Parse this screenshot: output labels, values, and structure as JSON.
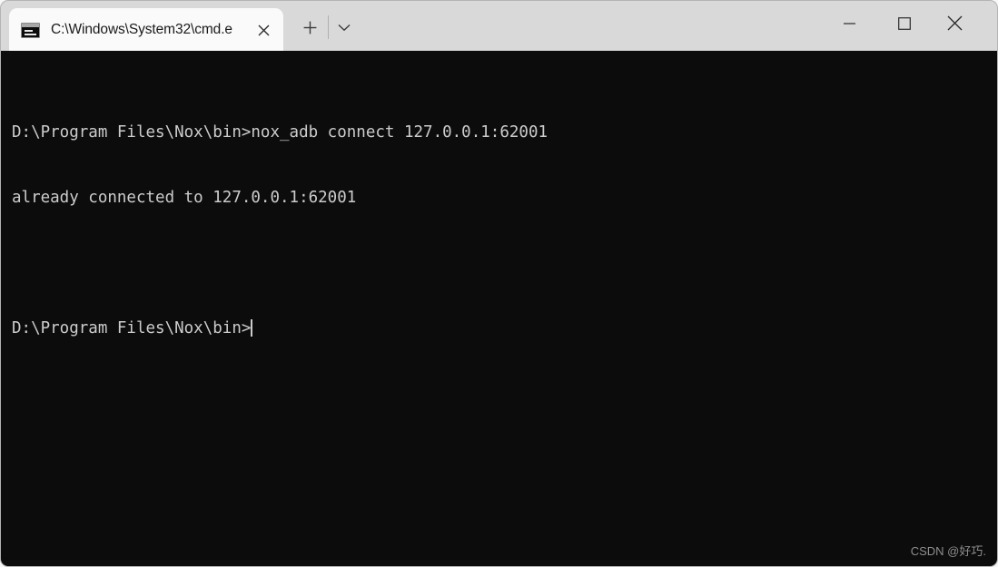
{
  "window": {
    "title_bar": {
      "background_color": "#d9d9d9",
      "tab": {
        "title": "C:\\Windows\\System32\\cmd.e",
        "icon": "console-icon",
        "close_label": "×"
      },
      "new_tab_label": "+",
      "dropdown_label": "⌄",
      "controls": {
        "minimize_label": "—",
        "maximize_label": "□",
        "close_label": "×"
      }
    }
  },
  "terminal": {
    "background_color": "#0c0c0c",
    "text_color": "#cccccc",
    "lines": [
      "D:\\Program Files\\Nox\\bin>nox_adb connect 127.0.0.1:62001",
      "already connected to 127.0.0.1:62001",
      "",
      "D:\\Program Files\\Nox\\bin>"
    ],
    "prompt_line_index": 3,
    "cursor_visible": true
  },
  "watermark": {
    "text": "CSDN @好巧."
  }
}
